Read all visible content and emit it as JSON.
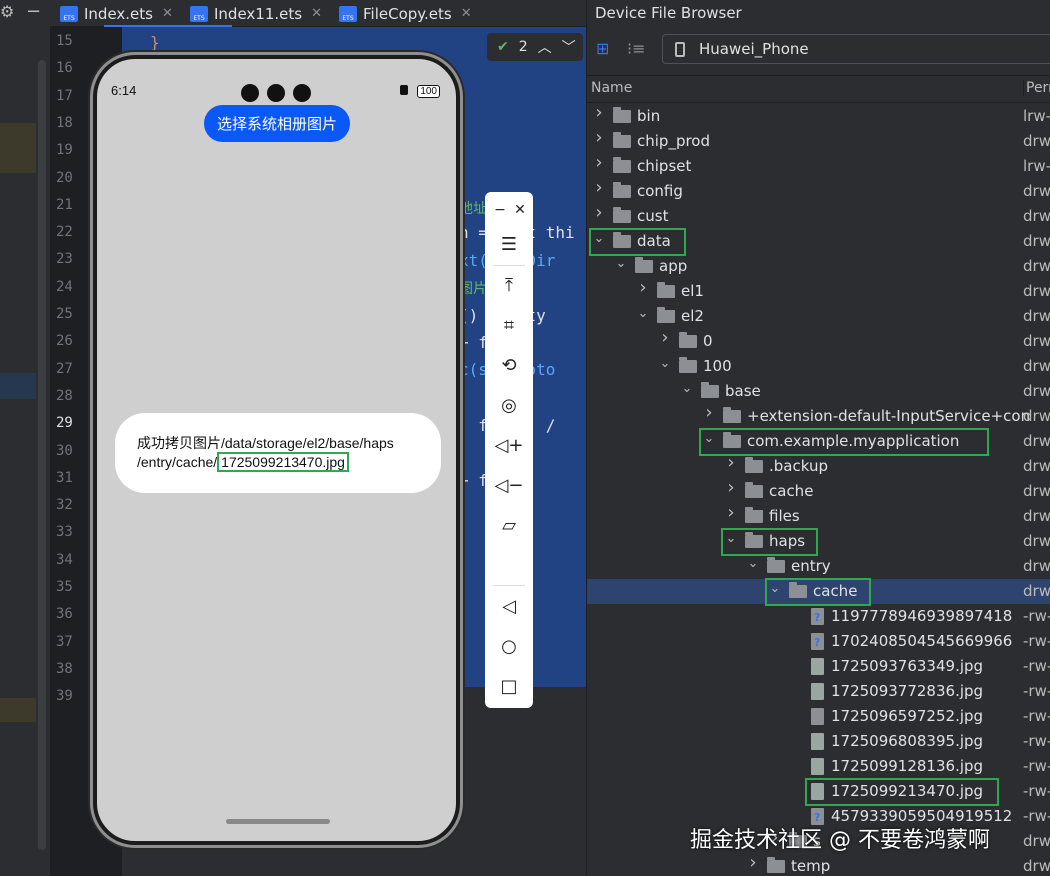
{
  "ide": {
    "tabs": [
      {
        "label": "Index.ets"
      },
      {
        "label": "Index11.ets"
      },
      {
        "label": "FileCopy.ets"
      }
    ],
    "inspection_count": "2",
    "line_numbers": [
      "15",
      "16",
      "17",
      "18",
      "19",
      "20",
      "21",
      "22",
      "23",
      "24",
      "25",
      "26",
      "27",
      "28",
      "29",
      "30",
      "31",
      "32",
      "33",
      "34",
      "35",
      "36",
      "37",
      "38",
      "39"
    ],
    "current_line": "29",
    "code_fragments": [
      {
        "text": "}"
      },
      {
        "text": "地址"
      },
      {
        "text": "h = wait thi"
      },
      {
        "text": "xt( cheDir"
      },
      {
        "text": "图片"
      },
      {
        "text": "() ' + ty"
      },
      {
        "text": "+ fine"
      },
      {
        "text": "c(s mPhoto"
      },
      {
        "text": ", f ath) /"
      },
      {
        "text": "+ f th"
      }
    ]
  },
  "emulator": {
    "time": "6:14",
    "battery": "100",
    "pick_button": "选择系统相册图片",
    "result_prefix": "成功拷贝图片/data/storage/el2/base/haps",
    "result_line2_prefix": "/entry/cache/",
    "result_filename": "1725099213470.jpg",
    "toolbar_icons": [
      "minimize-icon",
      "close-icon",
      "menu-icon",
      "pin-top-icon",
      "crop-icon",
      "rotate-icon",
      "screenshot-icon",
      "volume-up-icon",
      "volume-down-icon",
      "rotate-device-icon",
      "back-icon",
      "home-icon",
      "recents-icon"
    ]
  },
  "dfb": {
    "title": "Device File Browser",
    "device": "Huawei_Phone",
    "columns": {
      "name": "Name",
      "permissions": "Pern"
    },
    "rows": [
      {
        "label": "bin",
        "perm": "lrw-",
        "depth": 0,
        "type": "link",
        "expanded": false
      },
      {
        "label": "chip_prod",
        "perm": "drw",
        "depth": 0,
        "type": "folder",
        "expanded": false
      },
      {
        "label": "chipset",
        "perm": "lrw-",
        "depth": 0,
        "type": "link",
        "expanded": false
      },
      {
        "label": "config",
        "perm": "drw",
        "depth": 0,
        "type": "folder",
        "expanded": false
      },
      {
        "label": "cust",
        "perm": "drw",
        "depth": 0,
        "type": "folder",
        "expanded": false
      },
      {
        "label": "data",
        "perm": "drw",
        "depth": 0,
        "type": "folder",
        "expanded": true,
        "highlight": true
      },
      {
        "label": "app",
        "perm": "drw",
        "depth": 1,
        "type": "folder",
        "expanded": true
      },
      {
        "label": "el1",
        "perm": "drw",
        "depth": 2,
        "type": "folder",
        "expanded": false
      },
      {
        "label": "el2",
        "perm": "drw",
        "depth": 2,
        "type": "folder",
        "expanded": true
      },
      {
        "label": "0",
        "perm": "drw",
        "depth": 3,
        "type": "folder",
        "expanded": false
      },
      {
        "label": "100",
        "perm": "drw",
        "depth": 3,
        "type": "folder",
        "expanded": true
      },
      {
        "label": "base",
        "perm": "drw",
        "depth": 4,
        "type": "folder",
        "expanded": true
      },
      {
        "label": "+extension-default-InputService+con",
        "perm": "drw",
        "depth": 5,
        "type": "folder",
        "expanded": false
      },
      {
        "label": "com.example.myapplication",
        "perm": "drw",
        "depth": 5,
        "type": "folder",
        "expanded": true,
        "highlight": true
      },
      {
        "label": ".backup",
        "perm": "drw",
        "depth": 6,
        "type": "folder",
        "expanded": false
      },
      {
        "label": "cache",
        "perm": "drw",
        "depth": 6,
        "type": "folder",
        "expanded": false
      },
      {
        "label": "files",
        "perm": "drw",
        "depth": 6,
        "type": "folder",
        "expanded": false
      },
      {
        "label": "haps",
        "perm": "drw",
        "depth": 6,
        "type": "folder",
        "expanded": true,
        "highlight": true
      },
      {
        "label": "entry",
        "perm": "drw",
        "depth": 7,
        "type": "folder",
        "expanded": true
      },
      {
        "label": "cache",
        "perm": "drw",
        "depth": 8,
        "type": "folder",
        "expanded": true,
        "highlight": true,
        "selected": true
      },
      {
        "label": "1197778946939897418",
        "perm": "-rw-",
        "depth": 9,
        "type": "unknown"
      },
      {
        "label": "1702408504545669966",
        "perm": "-rw-",
        "depth": 9,
        "type": "unknown"
      },
      {
        "label": "1725093763349.jpg",
        "perm": "-rw-",
        "depth": 9,
        "type": "image"
      },
      {
        "label": "1725093772836.jpg",
        "perm": "-rw-",
        "depth": 9,
        "type": "image"
      },
      {
        "label": "1725096597252.jpg",
        "perm": "-rw-",
        "depth": 9,
        "type": "file"
      },
      {
        "label": "1725096808395.jpg",
        "perm": "-rw-",
        "depth": 9,
        "type": "image"
      },
      {
        "label": "1725099128136.jpg",
        "perm": "-rw-",
        "depth": 9,
        "type": "image"
      },
      {
        "label": "1725099213470.jpg",
        "perm": "-rw-",
        "depth": 9,
        "type": "image",
        "highlight": true
      },
      {
        "label": "4579339059504919512",
        "perm": "-rw-",
        "depth": 9,
        "type": "unknown"
      },
      {
        "label": "s",
        "perm": "drw",
        "depth": 8,
        "type": "folder",
        "expanded": false
      },
      {
        "label": "temp",
        "perm": "drw",
        "depth": 7,
        "type": "folder",
        "expanded": false
      }
    ]
  },
  "watermark": "掘金技术社区 @ 不要卷鸿蒙啊",
  "colors": {
    "accent": "#3574f0",
    "highlight_box": "#2fa84f",
    "selected_row": "#2e436e",
    "emulator_button": "#0a59f7"
  }
}
